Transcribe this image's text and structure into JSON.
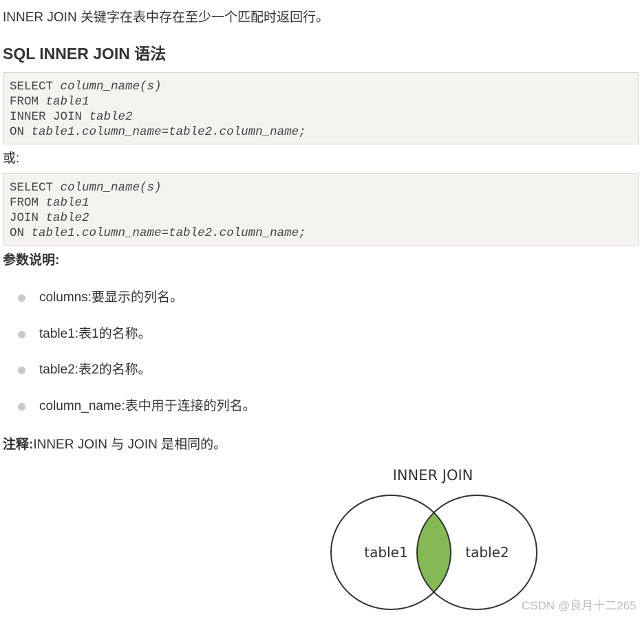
{
  "intro": "INNER JOIN 关键字在表中存在至少一个匹配时返回行。",
  "heading": "SQL INNER JOIN 语法",
  "code_block_1": {
    "lines": [
      {
        "keyword": "SELECT",
        "rest": "column_name(s)"
      },
      {
        "keyword": "FROM",
        "rest": "table1"
      },
      {
        "keyword": "INNER JOIN",
        "rest": "table2"
      },
      {
        "keyword": "ON",
        "rest": "table1.column_name=table2.column_name;"
      }
    ]
  },
  "or_text": "或:",
  "code_block_2": {
    "lines": [
      {
        "keyword": "SELECT",
        "rest": "column_name(s)"
      },
      {
        "keyword": "FROM",
        "rest": "table1"
      },
      {
        "keyword": "JOIN",
        "rest": "table2"
      },
      {
        "keyword": "ON",
        "rest": "table1.column_name=table2.column_name;"
      }
    ]
  },
  "params_label": "参数说明:",
  "params": [
    "columns:要显示的列名。",
    "table1:表1的名称。",
    "table2:表2的名称。",
    "column_name:表中用于连接的列名。"
  ],
  "note": {
    "label": "注释:",
    "text": "INNER JOIN 与 JOIN 是相同的。"
  },
  "diagram": {
    "title": "INNER JOIN",
    "left_label": "table1",
    "right_label": "table2",
    "intersection_color": "#84b955",
    "outline_color": "#333333"
  },
  "watermark": "CSDN @良月十二265"
}
